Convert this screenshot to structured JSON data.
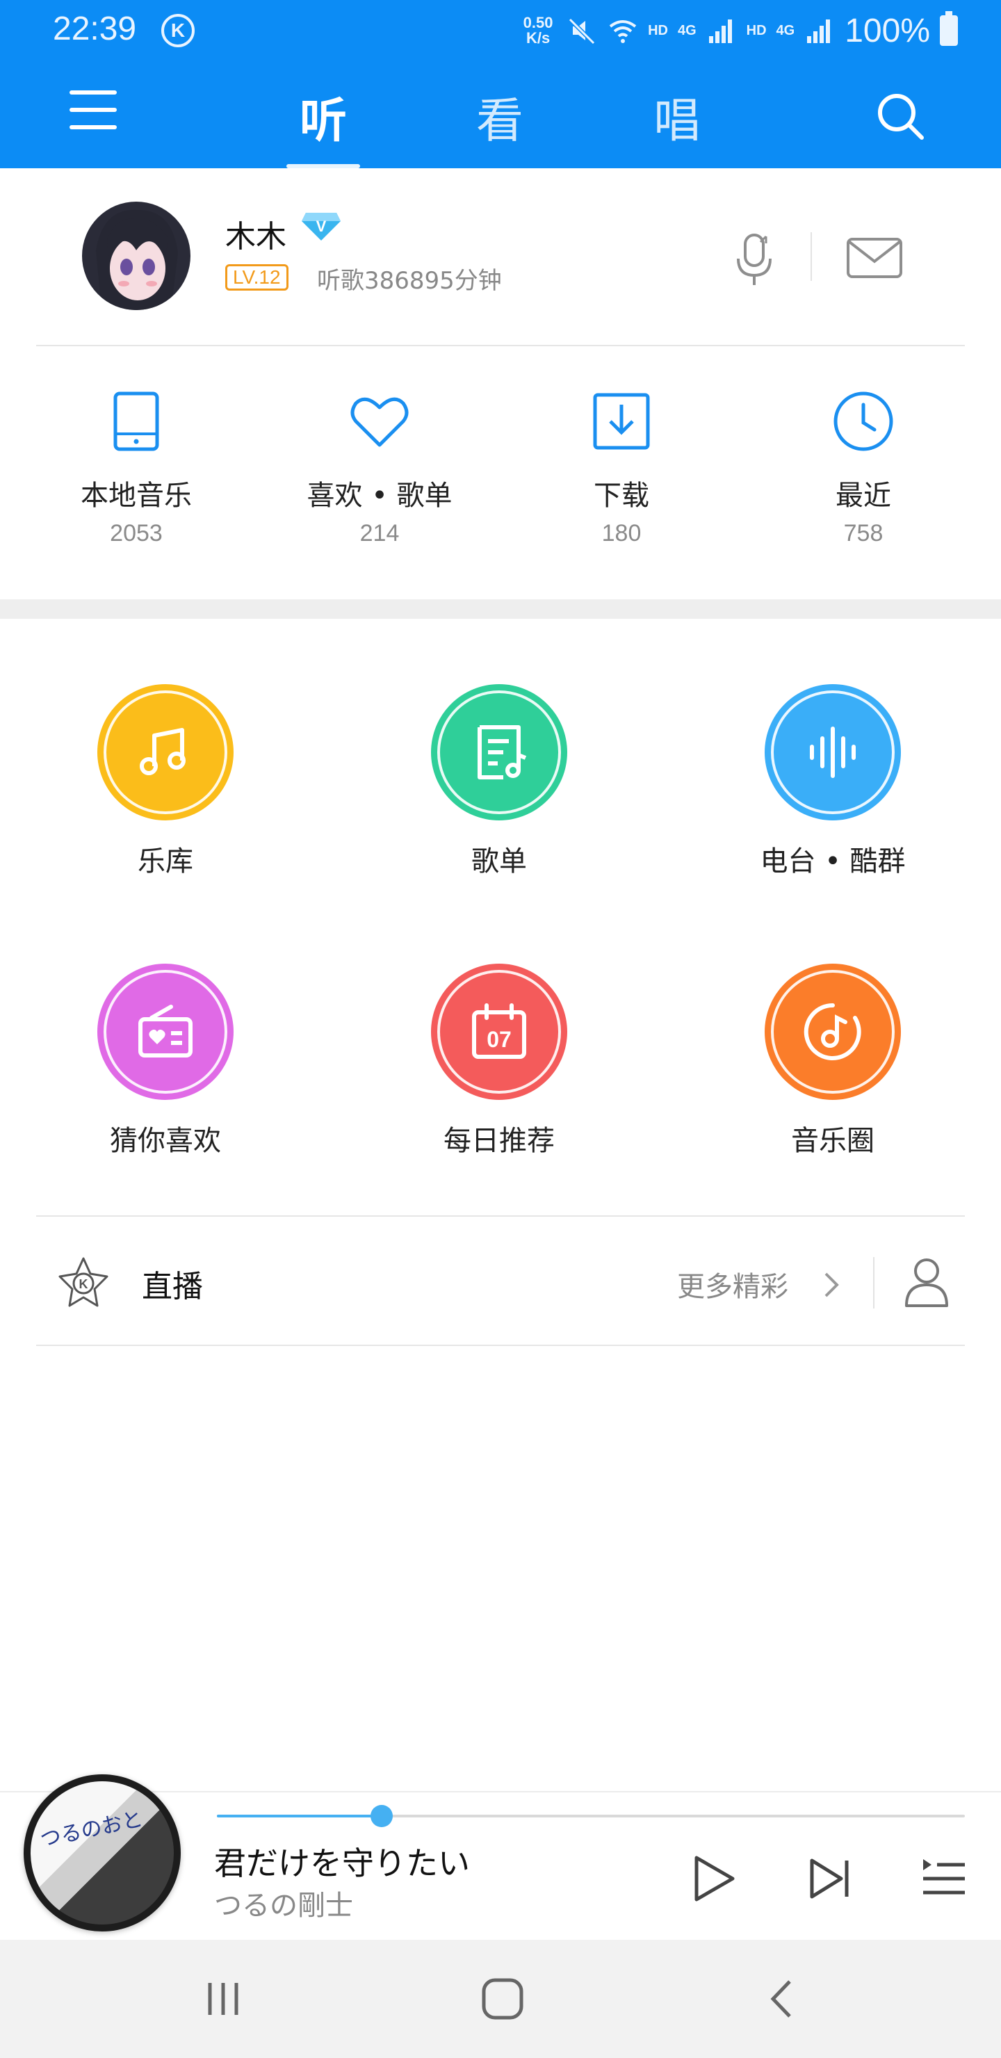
{
  "status_bar": {
    "time": "22:39",
    "k_badge": "K",
    "speed_value": "0.50",
    "speed_unit": "K/s",
    "net1": "HD",
    "net1_gen": "4G",
    "net2": "HD",
    "net2_gen": "4G",
    "battery": "100%"
  },
  "nav": {
    "tabs": [
      {
        "label": "听",
        "active": true
      },
      {
        "label": "看",
        "active": false
      },
      {
        "label": "唱",
        "active": false
      }
    ],
    "icons": {
      "menu": "menu-icon",
      "search": "search-icon"
    }
  },
  "profile": {
    "name": "木木",
    "vip_mark": "V",
    "level": "LV.12",
    "listen_time": "听歌386895分钟"
  },
  "quick_stats": [
    {
      "label": "本地音乐",
      "count": "2053",
      "icon": "tablet-icon"
    },
    {
      "label": "喜欢 • 歌单",
      "count": "214",
      "icon": "heart-icon"
    },
    {
      "label": "下载",
      "count": "180",
      "icon": "download-icon"
    },
    {
      "label": "最近",
      "count": "758",
      "icon": "clock-icon"
    }
  ],
  "features": [
    {
      "label": "乐库",
      "icon": "music-note-icon",
      "color": "#fbbd1a"
    },
    {
      "label": "歌单",
      "icon": "playlist-icon",
      "color": "#2fcf99"
    },
    {
      "label": "电台 • 酷群",
      "icon": "soundwave-icon",
      "color": "#3aaef8"
    },
    {
      "label": "猜你喜欢",
      "icon": "radio-heart-icon",
      "color": "#e06ae6"
    },
    {
      "label": "每日推荐",
      "icon": "calendar-icon",
      "color": "#f45b5b",
      "day": "07"
    },
    {
      "label": "音乐圈",
      "icon": "music-circle-icon",
      "color": "#fb7d2a"
    }
  ],
  "live": {
    "title": "直播",
    "more": "更多精彩"
  },
  "player": {
    "title": "君だけを守りたい",
    "artist": "つるの剛士",
    "cover_text": "つるのおと",
    "progress": 0.22
  }
}
